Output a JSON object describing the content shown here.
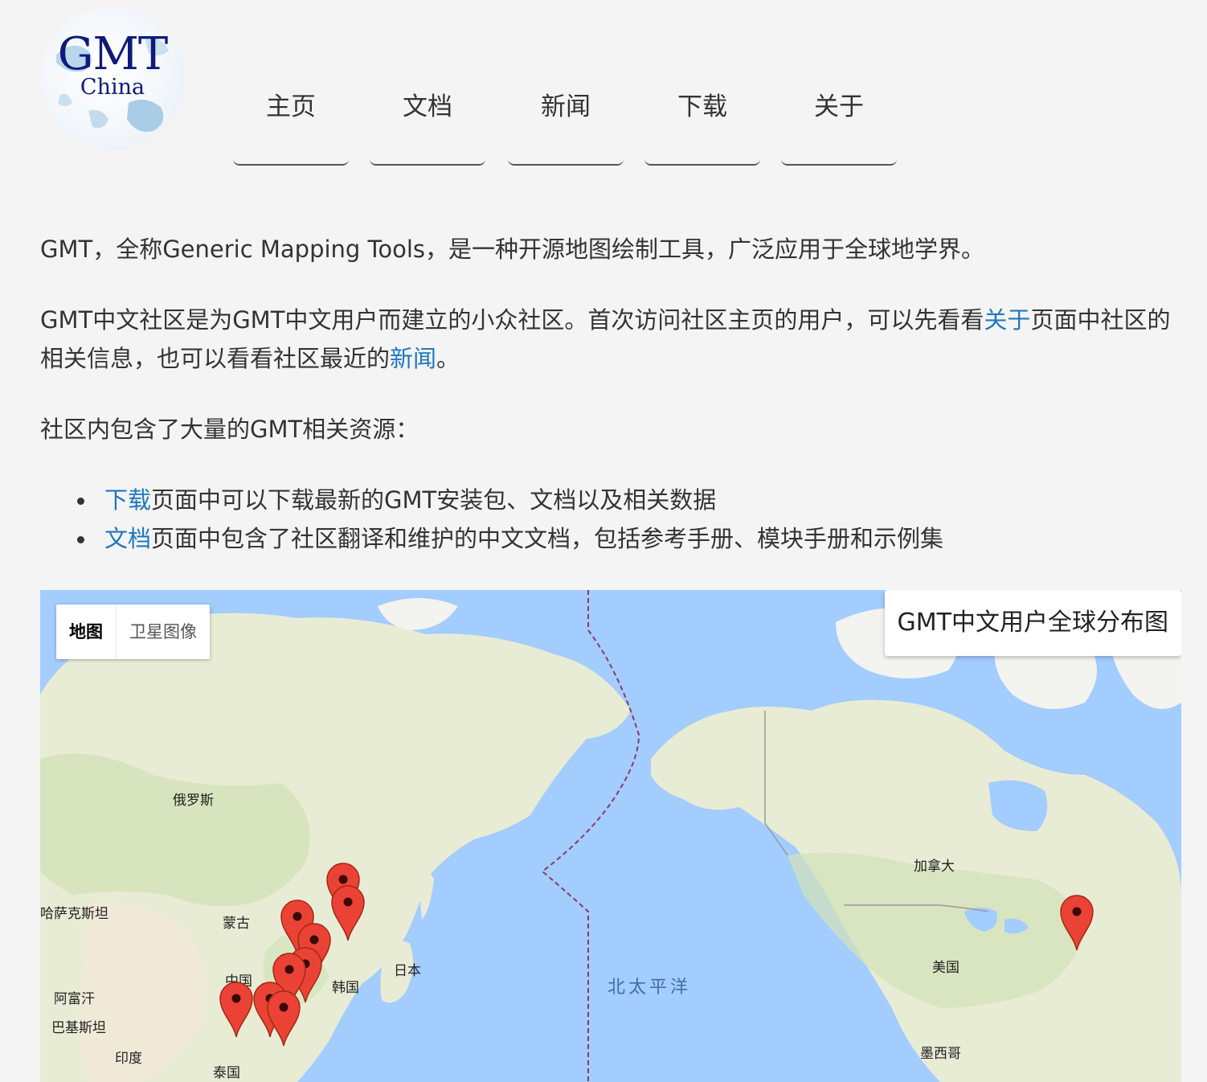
{
  "logo": {
    "line1": "GMT",
    "line2": "China"
  },
  "nav": [
    {
      "label": "主页"
    },
    {
      "label": "文档"
    },
    {
      "label": "新闻"
    },
    {
      "label": "下载"
    },
    {
      "label": "关于"
    }
  ],
  "intro": {
    "p1": "GMT，全称Generic Mapping Tools，是一种开源地图绘制工具，广泛应用于全球地学界。",
    "p2_before": "GMT中文社区是为GMT中文用户而建立的小众社区。首次访问社区主页的用户，可以先看看",
    "p2_link1": "关于",
    "p2_mid": "页面中社区的相关信息，也可以看看社区最近的",
    "p2_link2": "新闻",
    "p2_after": "。",
    "p3": "社区内包含了大量的GMT相关资源："
  },
  "resources": [
    {
      "link": "下载",
      "text": "页面中可以下载最新的GMT安装包、文档以及相关数据"
    },
    {
      "link": "文档",
      "text": "页面中包含了社区翻译和维护的中文文档，包括参考手册、模块手册和示例集"
    }
  ],
  "map": {
    "type_buttons": {
      "map": "地图",
      "satellite": "卫星图像"
    },
    "title": "GMT中文用户全球分布图",
    "labels": {
      "russia": "俄罗斯",
      "kazakhstan": "哈萨克斯坦",
      "mongolia": "蒙古",
      "china": "中国",
      "afghanistan": "阿富汗",
      "pakistan": "巴基斯坦",
      "india": "印度",
      "thailand": "泰国",
      "korea": "韩国",
      "japan": "日本",
      "north_pacific": "北太平洋",
      "canada": "加拿大",
      "usa": "美国",
      "mexico": "墨西哥"
    },
    "colors": {
      "ocean": "#a3ccff",
      "land": "#e8ecd5",
      "marker": "#ea4335"
    }
  }
}
